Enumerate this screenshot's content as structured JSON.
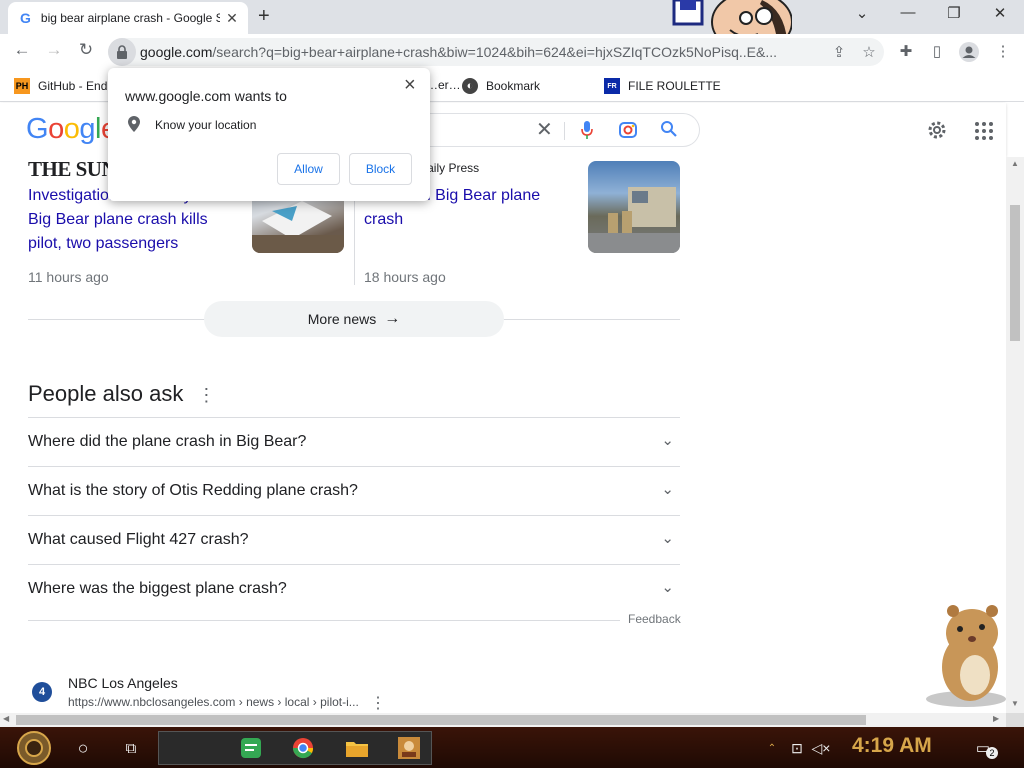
{
  "tab": {
    "title": "big bear airplane crash - Google Search",
    "favicon": "G"
  },
  "window": {
    "minimize": "—",
    "restore": "❐",
    "close": "✕",
    "tab_list": "⌄"
  },
  "toolbar": {
    "url_host": "google.com",
    "url_rest": "/search?q=big+bear+airplane+crash&biw=1024&bih=624&ei=hjxSZIqTCOzk5NoPisq..E&..."
  },
  "bookmarks": [
    {
      "label": "GitHub - End",
      "fav": "PH",
      "fav_bg": "#f7971e",
      "fav_color": "#000"
    },
    {
      "label": "…er…",
      "fav": "",
      "fav_bg": "#fff",
      "fav_color": "#000"
    },
    {
      "label": "Bookmark",
      "fav": "◐",
      "fav_bg": "#fff",
      "fav_color": "#333"
    },
    {
      "label": "FILE ROULETTE",
      "fav": "FR",
      "fav_bg": "#0a2aa8",
      "fav_color": "#fff"
    }
  ],
  "google": {
    "logo": "Google"
  },
  "news": [
    {
      "source": "THE SUN",
      "title": "Investigation underway after Big Bear plane crash kills pilot, two passengers",
      "time": "11 hours ago"
    },
    {
      "source": "Victorville Daily Press",
      "title": "3 killed in Big Bear plane crash",
      "time": "18 hours ago"
    }
  ],
  "more_news": "More news",
  "paa": {
    "title": "People also ask",
    "questions": [
      "Where did the plane crash in Big Bear?",
      "What is the story of Otis Redding plane crash?",
      "What caused Flight 427 crash?",
      "Where was the biggest plane crash?"
    ],
    "feedback": "Feedback"
  },
  "result": {
    "site": "NBC Los Angeles",
    "url": "https://www.nbclosangeles.com › news › local › pilot-i...",
    "fav": "4"
  },
  "popup": {
    "header": "www.google.com wants to",
    "permission": "Know your location",
    "allow": "Allow",
    "block": "Block",
    "close": "×"
  },
  "taskbar": {
    "clock": "4:19 AM",
    "notif_count": "2"
  },
  "colors": {
    "link": "#1a0dab",
    "accent": "#1a73e8",
    "clock": "#d7a64a"
  }
}
